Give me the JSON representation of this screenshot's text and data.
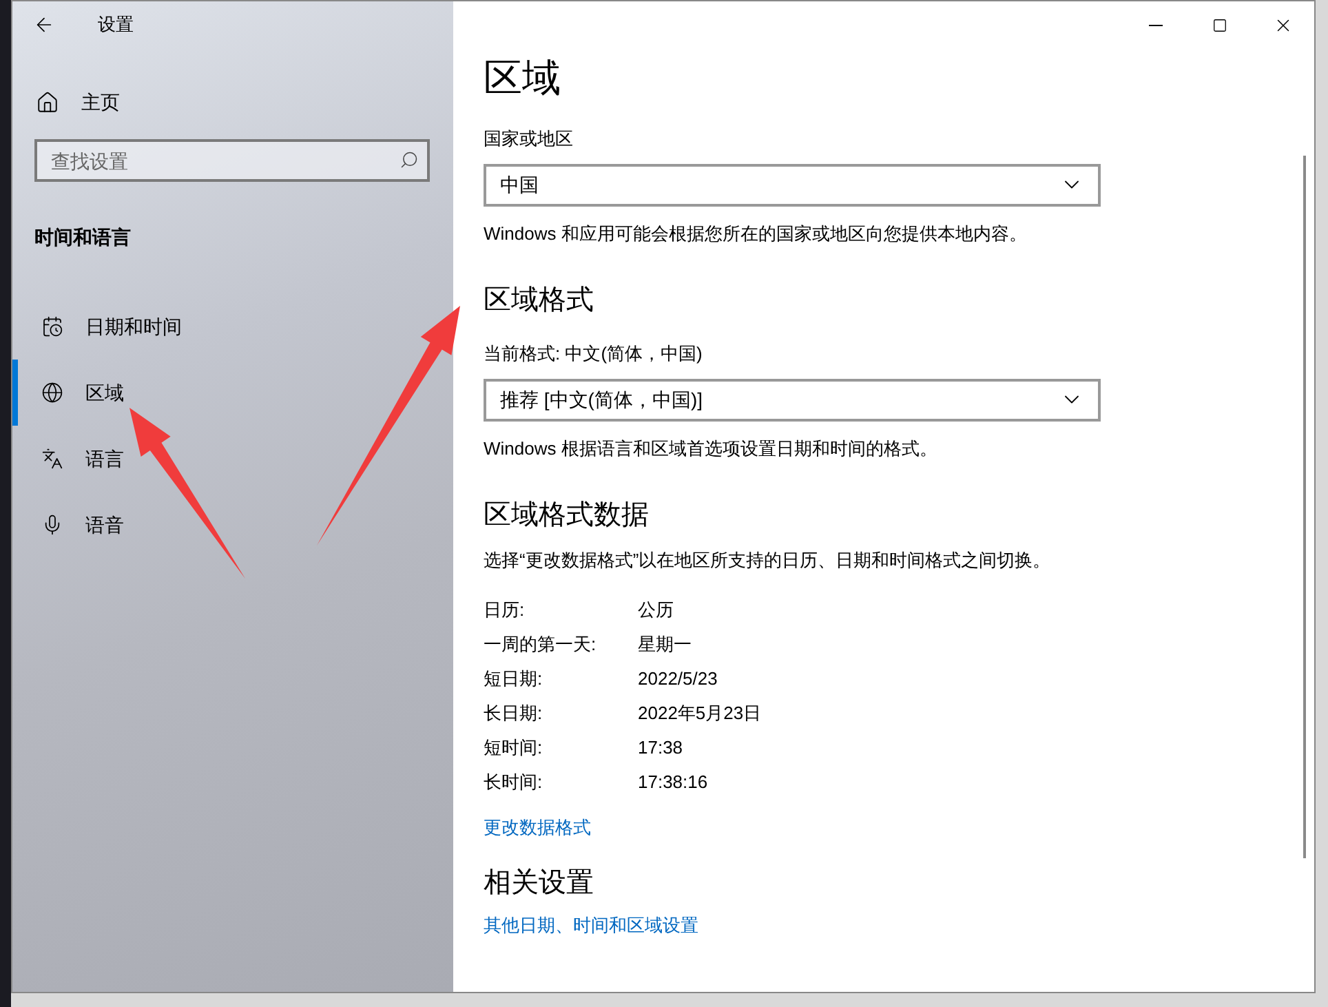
{
  "window": {
    "title": "设置"
  },
  "sidebar": {
    "home": "主页",
    "search": {
      "placeholder": "查找设置"
    },
    "section": "时间和语言",
    "items": [
      {
        "label": "日期和时间",
        "selected": false
      },
      {
        "label": "区域",
        "selected": true
      },
      {
        "label": "语言",
        "selected": false
      },
      {
        "label": "语音",
        "selected": false
      }
    ]
  },
  "page": {
    "title": "区域",
    "country": {
      "label": "国家或地区",
      "value": "中国",
      "note": "Windows 和应用可能会根据您所在的国家或地区向您提供本地内容。"
    },
    "format": {
      "heading": "区域格式",
      "label": "当前格式: 中文(简体，中国)",
      "value": "推荐 [中文(简体，中国)]",
      "note": "Windows 根据语言和区域首选项设置日期和时间的格式。"
    },
    "format_data": {
      "heading": "区域格式数据",
      "note": "选择“更改数据格式”以在地区所支持的日历、日期和时间格式之间切换。",
      "rows": [
        {
          "label": "日历:",
          "value": "公历"
        },
        {
          "label": "一周的第一天:",
          "value": "星期一"
        },
        {
          "label": "短日期:",
          "value": "2022/5/23"
        },
        {
          "label": "长日期:",
          "value": "2022年5月23日"
        },
        {
          "label": "短时间:",
          "value": "17:38"
        },
        {
          "label": "长时间:",
          "value": "17:38:16"
        }
      ],
      "link": "更改数据格式"
    },
    "related": {
      "heading": "相关设置",
      "link": "其他日期、时间和区域设置"
    }
  }
}
